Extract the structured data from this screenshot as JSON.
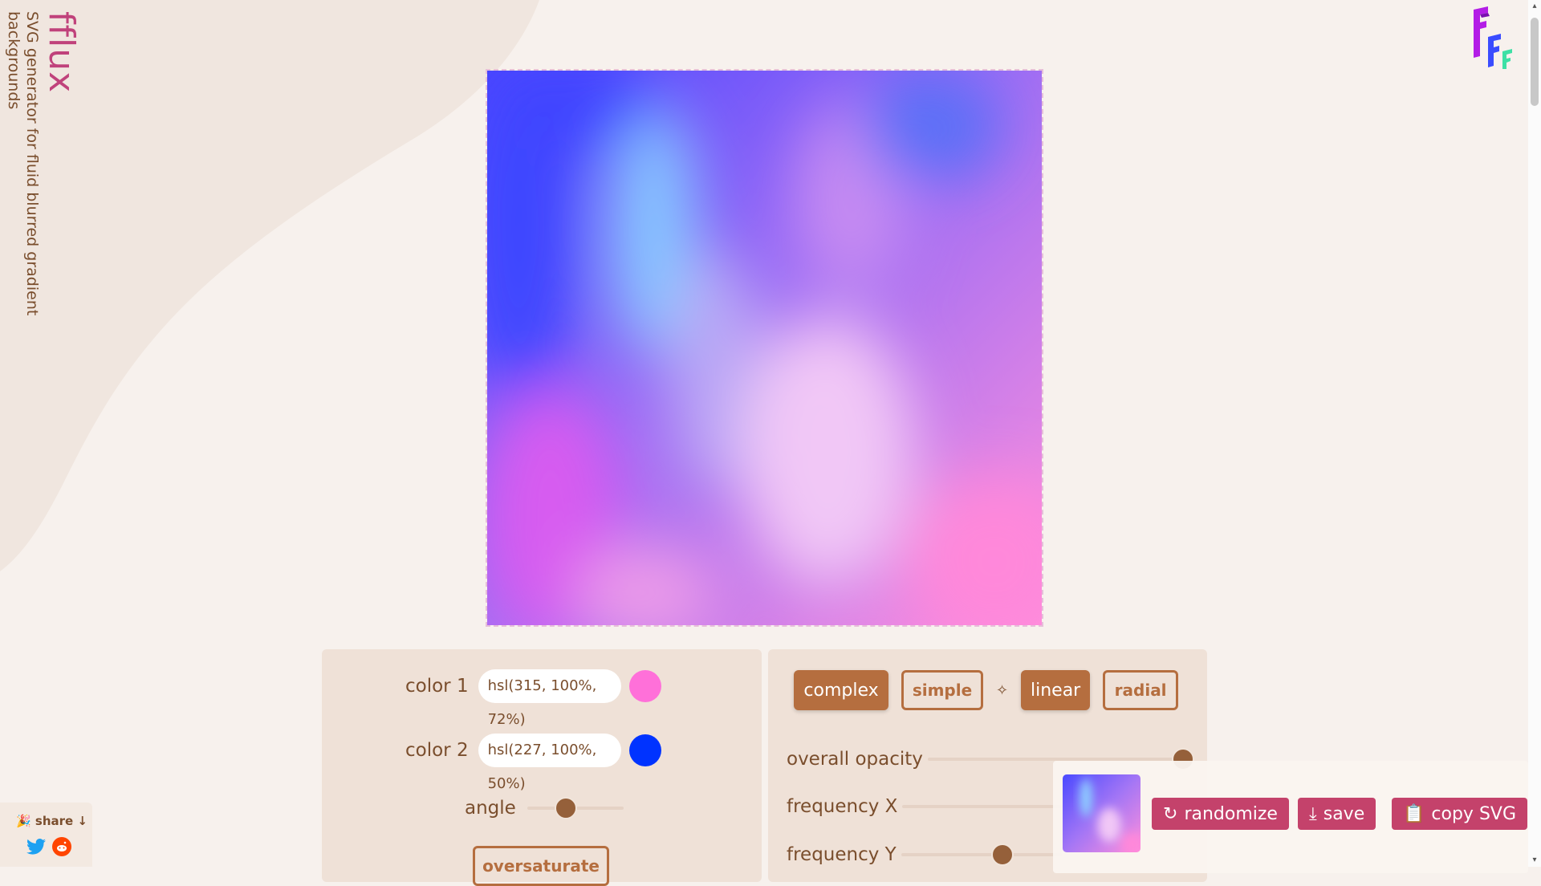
{
  "brand": {
    "name": "fflux",
    "tagline_line1": "SVG generator for fluid blurred gradient",
    "tagline_line2": "backgrounds"
  },
  "logo": {
    "icon": "fff-logo-icon",
    "colors": [
      "#a020f0",
      "#3a4cff",
      "#3de0a5"
    ]
  },
  "preview": {
    "colors": [
      "#4748ff",
      "#86c8ff",
      "#a65ff3",
      "#e59bf2",
      "#ff8fd8",
      "#dd62ea"
    ]
  },
  "left_panel": {
    "color1": {
      "label": "color 1",
      "value": "hsl(315, 100%, 72%)",
      "swatch": "#ff70d9"
    },
    "color2": {
      "label": "color 2",
      "value": "hsl(227, 100%, 50%)",
      "swatch": "#0033ff"
    },
    "angle": {
      "label": "angle",
      "value_fraction": 0.4
    },
    "oversaturate": {
      "label": "oversaturate"
    }
  },
  "right_panel": {
    "mode_buttons": [
      {
        "label": "complex",
        "selected": true
      },
      {
        "label": "simple",
        "selected": false
      }
    ],
    "separator": "✧",
    "gradient_buttons": [
      {
        "label": "linear",
        "selected": true
      },
      {
        "label": "radial",
        "selected": false
      }
    ],
    "sliders": [
      {
        "label": "overall opacity",
        "value_fraction": 0.98
      },
      {
        "label": "frequency X",
        "value_fraction": 0.9
      },
      {
        "label": "frequency Y",
        "value_fraction": 0.35
      }
    ]
  },
  "actions": {
    "randomize": {
      "label": "randomize",
      "icon": "refresh-icon"
    },
    "save": {
      "label": "save",
      "icon": "download-icon"
    },
    "copy_svg": {
      "label": "copy SVG",
      "icon": "clipboard-icon"
    }
  },
  "share": {
    "label": "🎉 share ↓",
    "networks": [
      "twitter",
      "reddit"
    ]
  },
  "colors": {
    "accent": "#b56e3f",
    "action": "#c4426b",
    "brand": "#c0427b",
    "text": "#7a4e2d",
    "panel": "#efe1d7"
  }
}
